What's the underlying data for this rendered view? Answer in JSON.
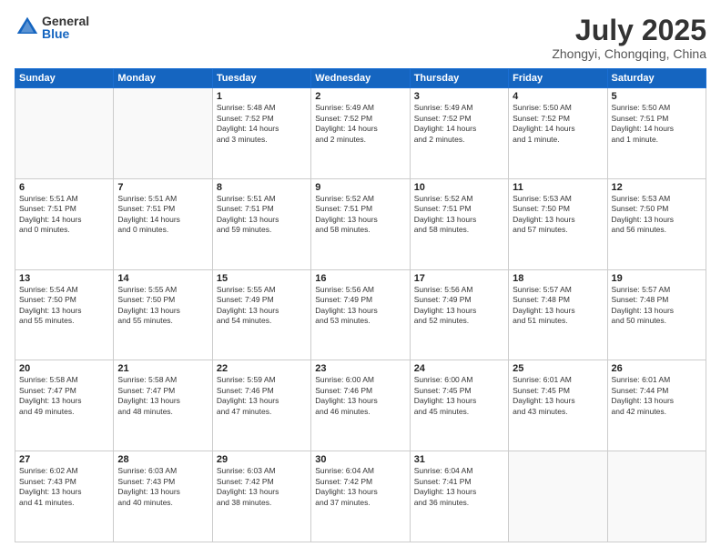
{
  "header": {
    "logo_general": "General",
    "logo_blue": "Blue",
    "month_title": "July 2025",
    "location": "Zhongyi, Chongqing, China"
  },
  "weekdays": [
    "Sunday",
    "Monday",
    "Tuesday",
    "Wednesday",
    "Thursday",
    "Friday",
    "Saturday"
  ],
  "weeks": [
    [
      {
        "day": "",
        "info": ""
      },
      {
        "day": "",
        "info": ""
      },
      {
        "day": "1",
        "info": "Sunrise: 5:48 AM\nSunset: 7:52 PM\nDaylight: 14 hours\nand 3 minutes."
      },
      {
        "day": "2",
        "info": "Sunrise: 5:49 AM\nSunset: 7:52 PM\nDaylight: 14 hours\nand 2 minutes."
      },
      {
        "day": "3",
        "info": "Sunrise: 5:49 AM\nSunset: 7:52 PM\nDaylight: 14 hours\nand 2 minutes."
      },
      {
        "day": "4",
        "info": "Sunrise: 5:50 AM\nSunset: 7:52 PM\nDaylight: 14 hours\nand 1 minute."
      },
      {
        "day": "5",
        "info": "Sunrise: 5:50 AM\nSunset: 7:51 PM\nDaylight: 14 hours\nand 1 minute."
      }
    ],
    [
      {
        "day": "6",
        "info": "Sunrise: 5:51 AM\nSunset: 7:51 PM\nDaylight: 14 hours\nand 0 minutes."
      },
      {
        "day": "7",
        "info": "Sunrise: 5:51 AM\nSunset: 7:51 PM\nDaylight: 14 hours\nand 0 minutes."
      },
      {
        "day": "8",
        "info": "Sunrise: 5:51 AM\nSunset: 7:51 PM\nDaylight: 13 hours\nand 59 minutes."
      },
      {
        "day": "9",
        "info": "Sunrise: 5:52 AM\nSunset: 7:51 PM\nDaylight: 13 hours\nand 58 minutes."
      },
      {
        "day": "10",
        "info": "Sunrise: 5:52 AM\nSunset: 7:51 PM\nDaylight: 13 hours\nand 58 minutes."
      },
      {
        "day": "11",
        "info": "Sunrise: 5:53 AM\nSunset: 7:50 PM\nDaylight: 13 hours\nand 57 minutes."
      },
      {
        "day": "12",
        "info": "Sunrise: 5:53 AM\nSunset: 7:50 PM\nDaylight: 13 hours\nand 56 minutes."
      }
    ],
    [
      {
        "day": "13",
        "info": "Sunrise: 5:54 AM\nSunset: 7:50 PM\nDaylight: 13 hours\nand 55 minutes."
      },
      {
        "day": "14",
        "info": "Sunrise: 5:55 AM\nSunset: 7:50 PM\nDaylight: 13 hours\nand 55 minutes."
      },
      {
        "day": "15",
        "info": "Sunrise: 5:55 AM\nSunset: 7:49 PM\nDaylight: 13 hours\nand 54 minutes."
      },
      {
        "day": "16",
        "info": "Sunrise: 5:56 AM\nSunset: 7:49 PM\nDaylight: 13 hours\nand 53 minutes."
      },
      {
        "day": "17",
        "info": "Sunrise: 5:56 AM\nSunset: 7:49 PM\nDaylight: 13 hours\nand 52 minutes."
      },
      {
        "day": "18",
        "info": "Sunrise: 5:57 AM\nSunset: 7:48 PM\nDaylight: 13 hours\nand 51 minutes."
      },
      {
        "day": "19",
        "info": "Sunrise: 5:57 AM\nSunset: 7:48 PM\nDaylight: 13 hours\nand 50 minutes."
      }
    ],
    [
      {
        "day": "20",
        "info": "Sunrise: 5:58 AM\nSunset: 7:47 PM\nDaylight: 13 hours\nand 49 minutes."
      },
      {
        "day": "21",
        "info": "Sunrise: 5:58 AM\nSunset: 7:47 PM\nDaylight: 13 hours\nand 48 minutes."
      },
      {
        "day": "22",
        "info": "Sunrise: 5:59 AM\nSunset: 7:46 PM\nDaylight: 13 hours\nand 47 minutes."
      },
      {
        "day": "23",
        "info": "Sunrise: 6:00 AM\nSunset: 7:46 PM\nDaylight: 13 hours\nand 46 minutes."
      },
      {
        "day": "24",
        "info": "Sunrise: 6:00 AM\nSunset: 7:45 PM\nDaylight: 13 hours\nand 45 minutes."
      },
      {
        "day": "25",
        "info": "Sunrise: 6:01 AM\nSunset: 7:45 PM\nDaylight: 13 hours\nand 43 minutes."
      },
      {
        "day": "26",
        "info": "Sunrise: 6:01 AM\nSunset: 7:44 PM\nDaylight: 13 hours\nand 42 minutes."
      }
    ],
    [
      {
        "day": "27",
        "info": "Sunrise: 6:02 AM\nSunset: 7:43 PM\nDaylight: 13 hours\nand 41 minutes."
      },
      {
        "day": "28",
        "info": "Sunrise: 6:03 AM\nSunset: 7:43 PM\nDaylight: 13 hours\nand 40 minutes."
      },
      {
        "day": "29",
        "info": "Sunrise: 6:03 AM\nSunset: 7:42 PM\nDaylight: 13 hours\nand 38 minutes."
      },
      {
        "day": "30",
        "info": "Sunrise: 6:04 AM\nSunset: 7:42 PM\nDaylight: 13 hours\nand 37 minutes."
      },
      {
        "day": "31",
        "info": "Sunrise: 6:04 AM\nSunset: 7:41 PM\nDaylight: 13 hours\nand 36 minutes."
      },
      {
        "day": "",
        "info": ""
      },
      {
        "day": "",
        "info": ""
      }
    ]
  ]
}
